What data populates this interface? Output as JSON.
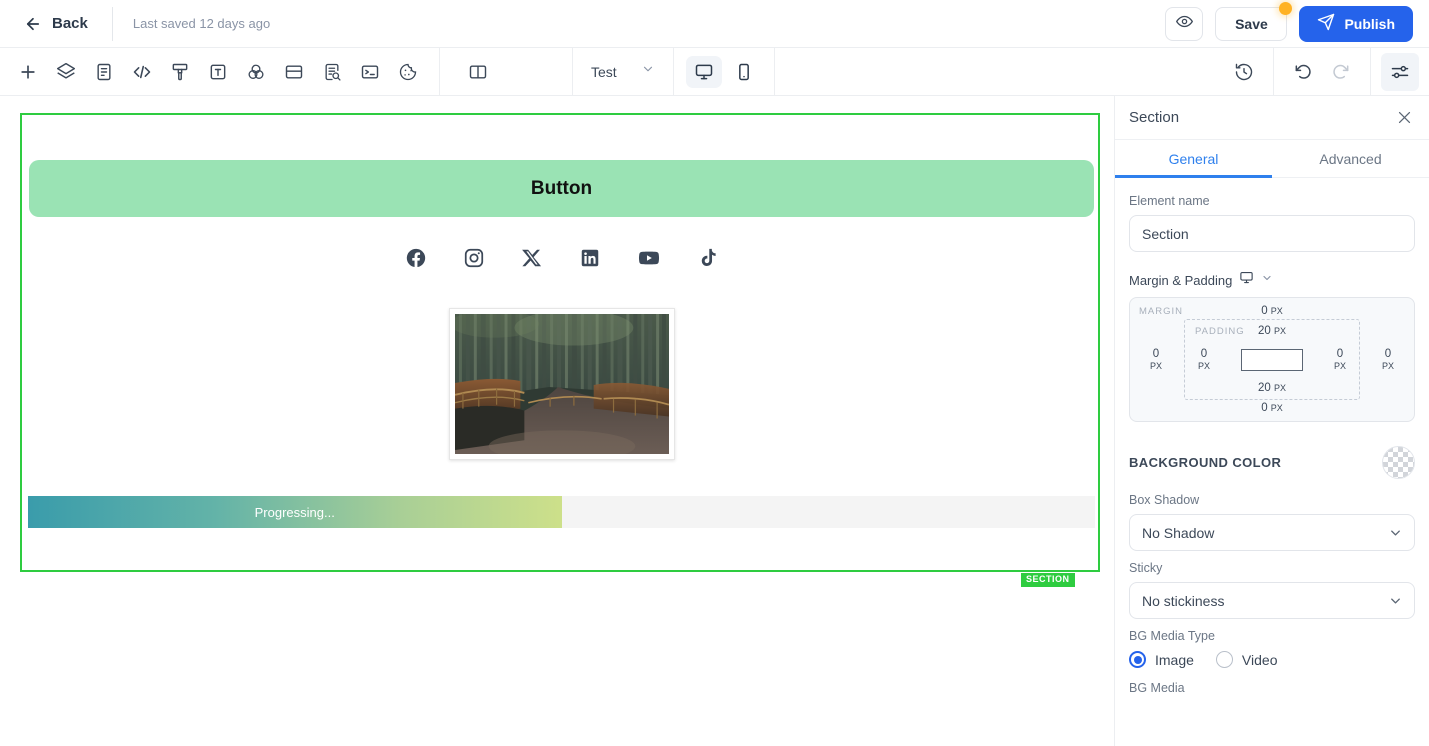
{
  "topbar": {
    "back_label": "Back",
    "saved_text": "Last saved 12 days ago",
    "preview_icon": "eye-icon",
    "save_label": "Save",
    "publish_label": "Publish",
    "publish_icon": "send-icon",
    "accent_blue": "#2563eb",
    "unsaved_dot_color": "#ffb224"
  },
  "toolbar": {
    "left_icons": [
      {
        "name": "add-icon",
        "title": "Add"
      },
      {
        "name": "layers-icon",
        "title": "Layers"
      },
      {
        "name": "pages-icon",
        "title": "Pages"
      },
      {
        "name": "code-icon",
        "title": "Code"
      },
      {
        "name": "brush-icon",
        "title": "Styles"
      },
      {
        "name": "typography-icon",
        "title": "Typography"
      },
      {
        "name": "color-blend-icon",
        "title": "Colors"
      },
      {
        "name": "card-icon",
        "title": "Components"
      },
      {
        "name": "seo-icon",
        "title": "SEO"
      },
      {
        "name": "terminal-icon",
        "title": "Console"
      },
      {
        "name": "cookie-icon",
        "title": "Cookies"
      }
    ],
    "split-view_icon": "split-view-icon",
    "page_select_value": "Test",
    "devices": [
      {
        "name": "desktop-icon",
        "active": true
      },
      {
        "name": "mobile-icon",
        "active": false
      }
    ],
    "right_icons": [
      {
        "name": "history-icon",
        "title": "History"
      },
      {
        "name": "undo-icon",
        "title": "Undo"
      },
      {
        "name": "redo-icon",
        "title": "Redo"
      },
      {
        "name": "settings-sliders-icon",
        "title": "Settings"
      }
    ]
  },
  "canvas": {
    "section_outline_color": "#2ecc40",
    "section_badge": "SECTION",
    "button": {
      "label": "Button",
      "background": "#9ae3b4",
      "text_color": "#111111"
    },
    "social_icons": [
      {
        "name": "facebook-icon",
        "label": "Facebook"
      },
      {
        "name": "instagram-icon",
        "label": "Instagram"
      },
      {
        "name": "x-twitter-icon",
        "label": "X"
      },
      {
        "name": "linkedin-icon",
        "label": "LinkedIn"
      },
      {
        "name": "youtube-icon",
        "label": "YouTube"
      },
      {
        "name": "tiktok-icon",
        "label": "TikTok"
      }
    ],
    "image": {
      "alt": "Bamboo forest path"
    },
    "progress": {
      "label": "Progressing...",
      "percent": 50,
      "gradient_from": "#3a9cab",
      "gradient_to": "#cde08a",
      "track_color": "#f4f4f4"
    }
  },
  "panel": {
    "title": "Section",
    "close_icon": "close-icon",
    "tabs": [
      {
        "label": "General",
        "active": true
      },
      {
        "label": "Advanced",
        "active": false
      }
    ],
    "element_name": {
      "label": "Element name",
      "value": "Section",
      "placeholder": "Element name"
    },
    "margin_padding": {
      "label": "Margin & Padding",
      "device_icon": "desktop-icon",
      "margin_tag": "MARGIN",
      "padding_tag": "PADDING",
      "margin": {
        "top": "0",
        "right": "0",
        "bottom": "0",
        "left": "0",
        "unit": "PX"
      },
      "padding": {
        "top": "20",
        "right": "0",
        "bottom": "20",
        "left": "0",
        "unit": "PX"
      }
    },
    "background_color": {
      "label": "BACKGROUND COLOR",
      "swatch": "transparent"
    },
    "box_shadow": {
      "label": "Box Shadow",
      "value": "No Shadow"
    },
    "sticky": {
      "label": "Sticky",
      "value": "No stickiness"
    },
    "bg_media_type": {
      "label": "BG Media Type",
      "options": [
        {
          "label": "Image",
          "selected": true
        },
        {
          "label": "Video",
          "selected": false
        }
      ]
    },
    "bg_media_label": "BG Media"
  }
}
